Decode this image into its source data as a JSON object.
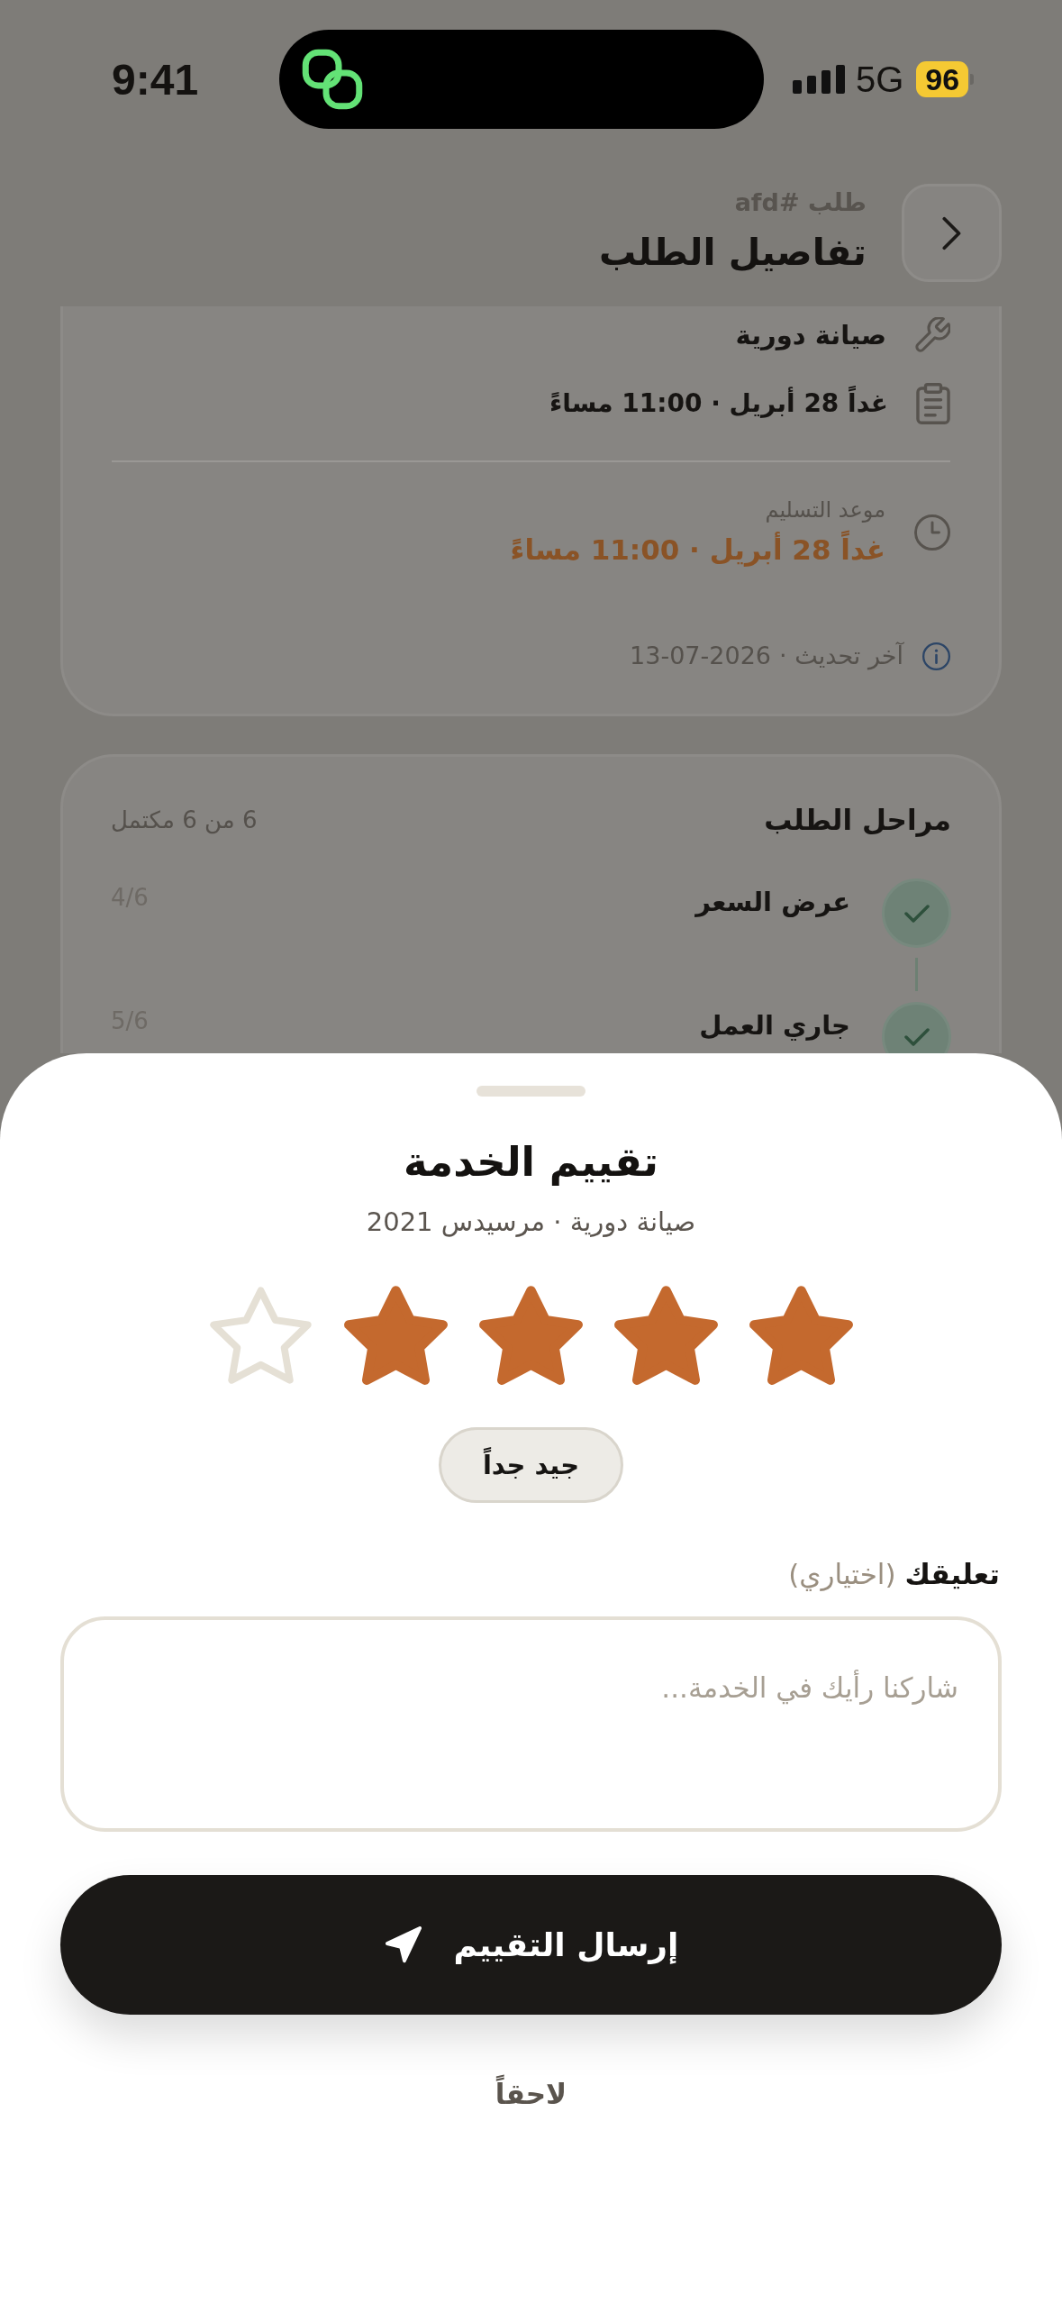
{
  "status_bar": {
    "time": "9:41",
    "network": "5G",
    "battery": "96"
  },
  "header": {
    "order_ref": "طلب #afd",
    "title": "تفاصيل الطلب"
  },
  "details_card": {
    "service": "صيانة دورية",
    "appointment": "غداً 28 أبريل · 11:00 مساءً",
    "delivery": {
      "label": "موعد التسليم",
      "value": "غداً 28 أبريل · 11:00 مساءً"
    },
    "last_update": {
      "label": "آخر تحديث ·",
      "date": "13-07-2026"
    }
  },
  "stages_card": {
    "title": "مراحل الطلب",
    "summary": "6 من 6 مكتمل",
    "steps": [
      {
        "name": "عرض السعر",
        "position": "4/6",
        "done": true
      },
      {
        "name": "جاري العمل",
        "position": "5/6",
        "done": true
      }
    ]
  },
  "rating_sheet": {
    "title": "تقييم الخدمة",
    "subtitle": "صيانة دورية · مرسيدس 2021",
    "stars": 4,
    "rating_label": "جيد جداً",
    "comment": {
      "label": "**تعليقك** (اختياري)",
      "placeholder": "شاركنا رأيك في الخدمة..."
    },
    "submit": "إرسال التقييم",
    "later": "لاحقاً"
  }
}
